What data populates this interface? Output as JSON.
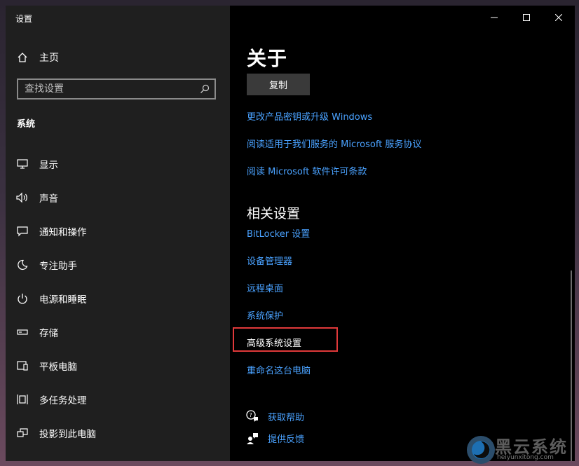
{
  "window": {
    "title": "设置"
  },
  "sidebar": {
    "home_label": "主页",
    "search_placeholder": "查找设置",
    "section_label": "系统",
    "items": [
      {
        "label": "显示",
        "icon": "display-icon"
      },
      {
        "label": "声音",
        "icon": "speaker-icon"
      },
      {
        "label": "通知和操作",
        "icon": "notification-icon"
      },
      {
        "label": "专注助手",
        "icon": "moon-icon"
      },
      {
        "label": "电源和睡眠",
        "icon": "power-icon"
      },
      {
        "label": "存储",
        "icon": "storage-icon"
      },
      {
        "label": "平板电脑",
        "icon": "tablet-icon"
      },
      {
        "label": "多任务处理",
        "icon": "multitask-icon"
      },
      {
        "label": "投影到此电脑",
        "icon": "project-icon"
      }
    ]
  },
  "main": {
    "title": "关于",
    "copy_button": "复制",
    "links": [
      "更改产品密钥或升级 Windows",
      "阅读适用于我们服务的 Microsoft 服务协议",
      "阅读 Microsoft 软件许可条款"
    ],
    "related_title": "相关设置",
    "related_links": [
      "BitLocker 设置",
      "设备管理器",
      "远程桌面",
      "系统保护",
      "高级系统设置",
      "重命名这台电脑"
    ],
    "help": [
      {
        "label": "获取帮助",
        "icon": "help-chat-icon"
      },
      {
        "label": "提供反馈",
        "icon": "feedback-icon"
      }
    ]
  },
  "colors": {
    "accent_link": "#4aa2ff",
    "highlight_border": "#e0393a",
    "sidebar_bg": "#1f1f1f",
    "content_bg": "#000000"
  },
  "watermark": {
    "name": "黑云系统",
    "url": "heiyunxitong.com"
  }
}
